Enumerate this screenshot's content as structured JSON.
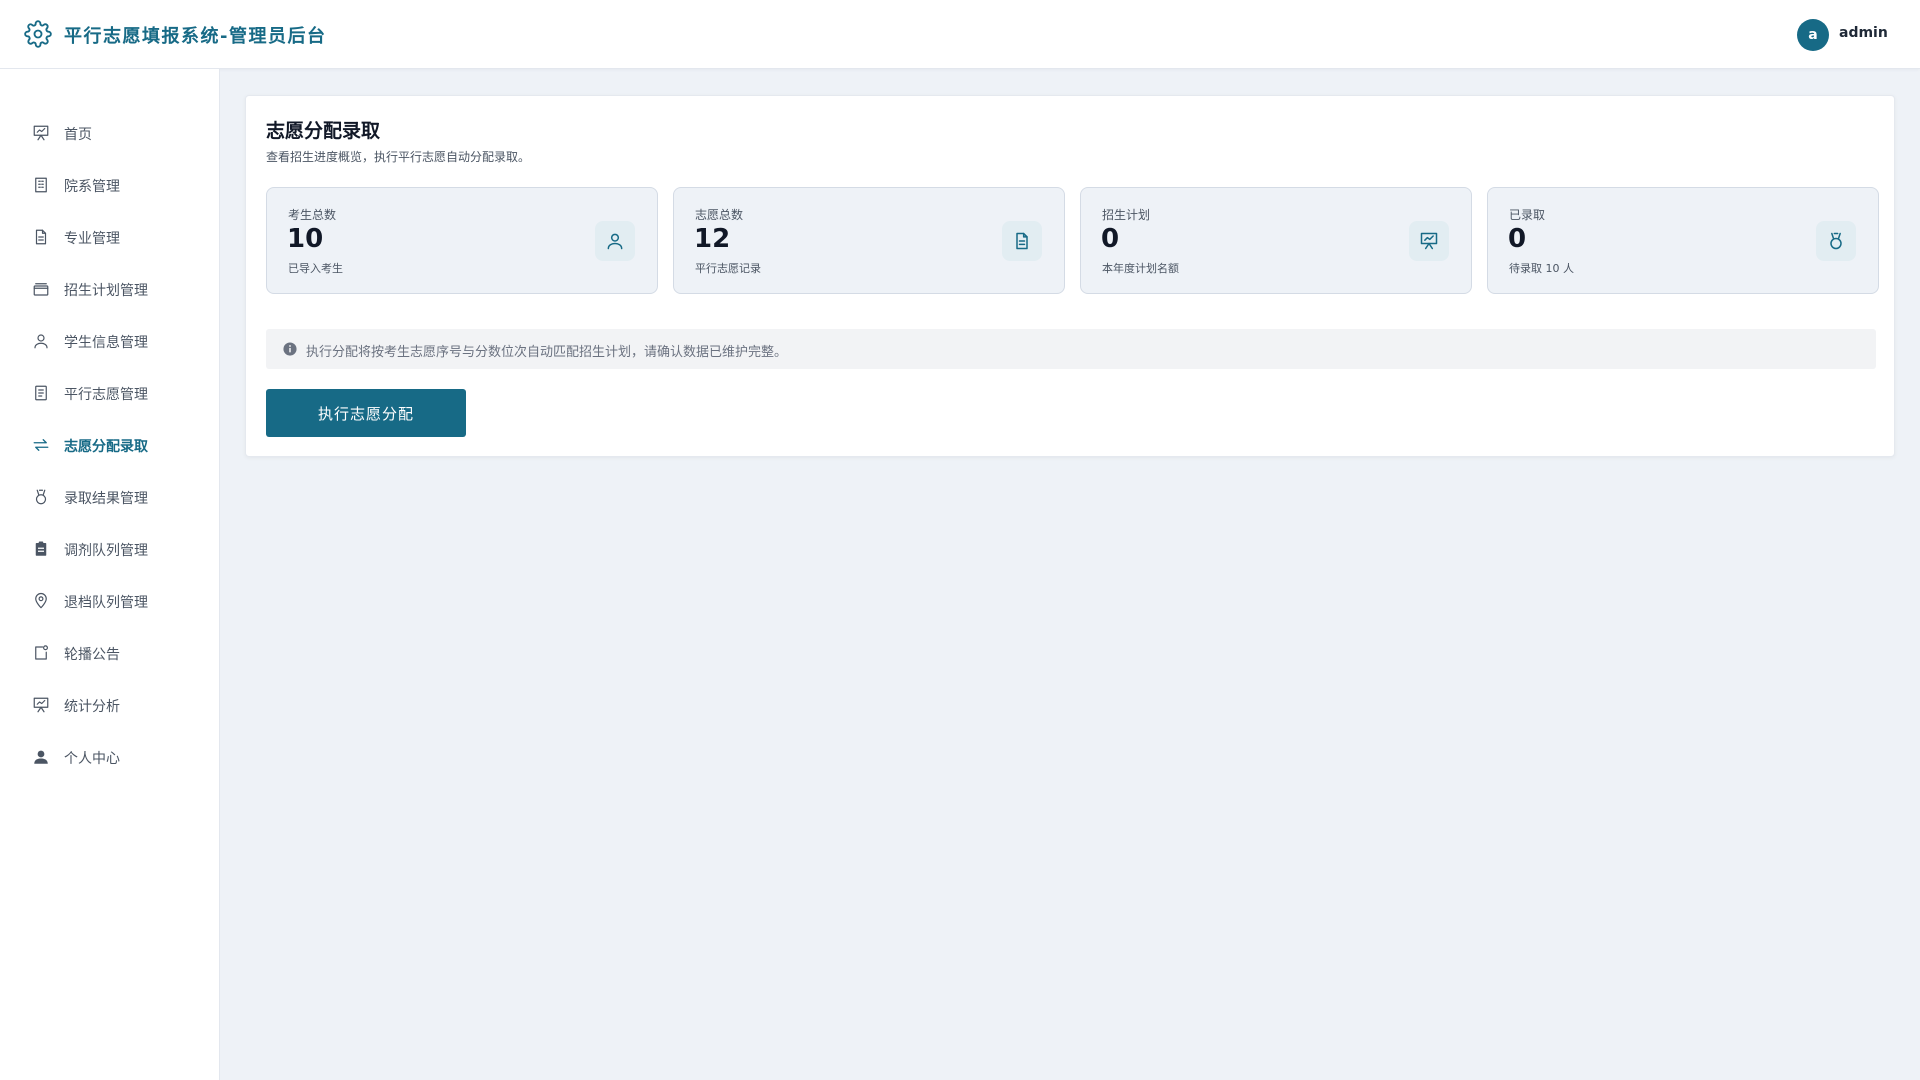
{
  "header": {
    "app_title": "平行志愿填报系统-管理员后台",
    "avatar_letter": "a",
    "username": "admin"
  },
  "sidebar": {
    "items": [
      {
        "label": "首页",
        "icon": "easel-chart-icon"
      },
      {
        "label": "院系管理",
        "icon": "building-icon"
      },
      {
        "label": "专业管理",
        "icon": "document-icon"
      },
      {
        "label": "招生计划管理",
        "icon": "wallet-icon"
      },
      {
        "label": "学生信息管理",
        "icon": "user-icon"
      },
      {
        "label": "平行志愿管理",
        "icon": "list-document-icon"
      },
      {
        "label": "志愿分配录取",
        "icon": "switch-arrows-icon",
        "active": true
      },
      {
        "label": "录取结果管理",
        "icon": "medal-icon"
      },
      {
        "label": "调剂队列管理",
        "icon": "clipboard-icon"
      },
      {
        "label": "退档队列管理",
        "icon": "location-pin-icon"
      },
      {
        "label": "轮播公告",
        "icon": "bell-note-icon"
      },
      {
        "label": "统计分析",
        "icon": "easel-chart-icon"
      },
      {
        "label": "个人中心",
        "icon": "user-filled-icon"
      }
    ]
  },
  "main": {
    "title": "志愿分配录取",
    "subtitle": "查看招生进度概览，执行平行志愿自动分配录取。",
    "stats": [
      {
        "label": "考生总数",
        "value": "10",
        "desc": "已导入考生",
        "icon": "user-icon"
      },
      {
        "label": "志愿总数",
        "value": "12",
        "desc": "平行志愿记录",
        "icon": "document-icon"
      },
      {
        "label": "招生计划",
        "value": "0",
        "desc": "本年度计划名额",
        "icon": "easel-chart-icon"
      },
      {
        "label": "已录取",
        "value": "0",
        "desc": "待录取 10 人",
        "icon": "medal-icon"
      }
    ],
    "notice": "执行分配将按考生志愿序号与分数位次自动匹配招生计划，请确认数据已维护完整。",
    "execute_button": "执行志愿分配"
  },
  "colors": {
    "accent": "#176a86",
    "background": "#eef2f7",
    "card_bg": "#eef2f7"
  }
}
